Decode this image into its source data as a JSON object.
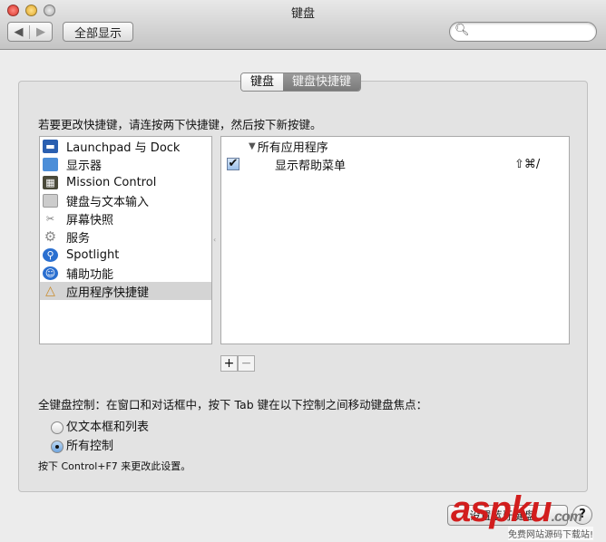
{
  "window": {
    "title": "键盘"
  },
  "toolbar": {
    "show_all": "全部显示",
    "search_placeholder": ""
  },
  "tabs": [
    {
      "label": "键盘",
      "selected": false
    },
    {
      "label": "键盘快捷键",
      "selected": true
    }
  ],
  "instruction": "若要更改快捷键，请连按两下快捷键，然后按下新按键。",
  "sidebar": {
    "items": [
      {
        "label": "Launchpad 与 Dock",
        "icon": "launchpad-dock-icon"
      },
      {
        "label": "显示器",
        "icon": "display-icon"
      },
      {
        "label": "Mission Control",
        "icon": "mission-control-icon"
      },
      {
        "label": "键盘与文本输入",
        "icon": "keyboard-icon"
      },
      {
        "label": "屏幕快照",
        "icon": "screenshot-icon"
      },
      {
        "label": "服务",
        "icon": "gear-icon"
      },
      {
        "label": "Spotlight",
        "icon": "spotlight-icon"
      },
      {
        "label": "辅助功能",
        "icon": "accessibility-icon"
      },
      {
        "label": "应用程序快捷键",
        "icon": "app-shortcuts-icon",
        "selected": true
      }
    ]
  },
  "shortcuts": {
    "group": "所有应用程序",
    "items": [
      {
        "label": "显示帮助菜单",
        "shortcut": "⇧⌘/",
        "checked": true
      }
    ]
  },
  "buttons": {
    "add": "+",
    "remove": "−",
    "bluetooth": "设置蓝牙键盘…",
    "help": "?"
  },
  "full_keyboard": {
    "label": "全键盘控制：在窗口和对话框中，按下 Tab 键在以下控制之间移动键盘焦点：",
    "options": [
      {
        "label": "仅文本框和列表",
        "selected": false
      },
      {
        "label": "所有控制",
        "selected": true
      }
    ],
    "note": "按下 Control+F7 来更改此设置。"
  },
  "watermark": {
    "text": "aspku.com",
    "subtext": "免费网站源码下载站!"
  }
}
